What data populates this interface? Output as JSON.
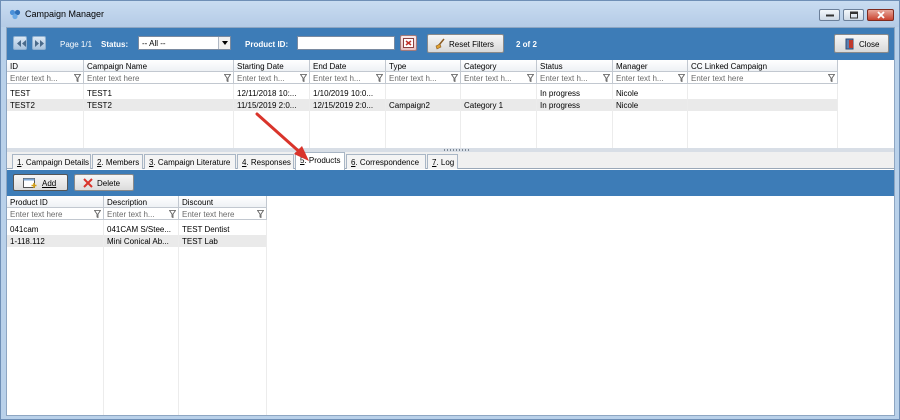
{
  "window": {
    "title": "Campaign Manager"
  },
  "toolbar": {
    "page_label": "Page 1/1",
    "status_label": "Status:",
    "status_value": "-- All --",
    "product_id_label": "Product ID:",
    "product_id_value": "",
    "reset_label": "Reset Filters",
    "record_count": "2 of 2",
    "close_label": "Close"
  },
  "campaign_grid": {
    "columns": [
      "ID",
      "Campaign Name",
      "Starting Date",
      "End Date",
      "Type",
      "Category",
      "Status",
      "Manager",
      "CC Linked Campaign"
    ],
    "filter_placeholders": [
      "Enter text h...",
      "Enter text here",
      "Enter text h...",
      "Enter text h...",
      "Enter text h...",
      "Enter text h...",
      "Enter text h...",
      "Enter text h...",
      "Enter text here"
    ],
    "rows": [
      [
        "TEST",
        "TEST1",
        "12/11/2018 10:...",
        "1/10/2019 10:0...",
        "",
        "",
        "In progress",
        "Nicole",
        ""
      ],
      [
        "TEST2",
        "TEST2",
        "11/15/2019 2:0...",
        "12/15/2019 2:0...",
        "Campaign2",
        "Category 1",
        "In progress",
        "Nicole",
        ""
      ]
    ]
  },
  "tabs": [
    {
      "num": "1",
      "label": ". Campaign Details"
    },
    {
      "num": "2",
      "label": ". Members"
    },
    {
      "num": "3",
      "label": ". Campaign Literature"
    },
    {
      "num": "4",
      "label": ". Responses"
    },
    {
      "num": "5",
      "label": ". Products"
    },
    {
      "num": "6",
      "label": ". Correspondence"
    },
    {
      "num": "7",
      "label": ". Log"
    }
  ],
  "products_toolbar": {
    "add_label": "Add",
    "delete_label": "Delete"
  },
  "products_grid": {
    "columns": [
      "Product ID",
      "Description",
      "Discount"
    ],
    "filter_placeholders": [
      "Enter text here",
      "Enter text h...",
      "Enter text here"
    ],
    "rows": [
      [
        "041cam",
        "041CAM S/Stee...",
        "TEST Dentist"
      ],
      [
        "1-118.112",
        "Mini Conical Ab...",
        "TEST Lab"
      ]
    ]
  },
  "colors": {
    "toolbar_blue": "#3d7cb7",
    "annotation_red": "#d9342b"
  }
}
